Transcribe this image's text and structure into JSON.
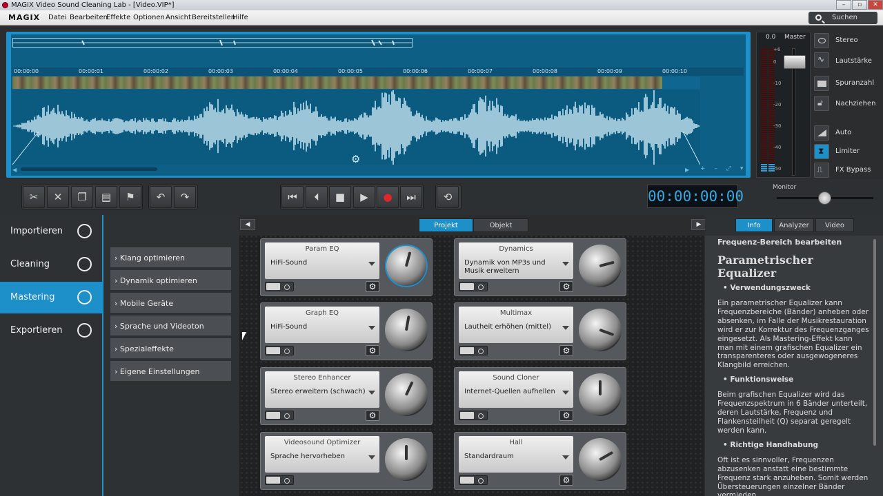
{
  "window": {
    "title": "MAGIX Video Sound Cleaning Lab - [Video.VIP*]"
  },
  "menu": {
    "logo": "MAGIX",
    "items": [
      "Datei",
      "Bearbeiten",
      "Effekte",
      "Optionen",
      "Ansicht",
      "Bereitstellen",
      "Hilfe"
    ],
    "search_label": "Suchen"
  },
  "timeline": {
    "ticks": [
      "00:00:00",
      "00:00:01",
      "00:00:02",
      "00:00:03",
      "00:00:04",
      "00:00:05",
      "00:00:06",
      "00:00:07",
      "00:00:08",
      "00:00:09",
      "00:00:10"
    ]
  },
  "master": {
    "level": "0.0",
    "label": "Master",
    "db_scale": [
      "+6",
      "0",
      "-10",
      "-20",
      "-30",
      "-40",
      "-50"
    ]
  },
  "side_controls": [
    "Stereo",
    "Lautstärke",
    "Spuranzahl",
    "Nachziehen",
    "Auto",
    "Limiter",
    "FX Bypass"
  ],
  "transport": {
    "timecode": "00:00:00:00",
    "monitor_label": "Monitor"
  },
  "nav": {
    "items": [
      {
        "label": "Importieren",
        "icon": "import-icon"
      },
      {
        "label": "Cleaning",
        "icon": "cleaning-icon"
      },
      {
        "label": "Mastering",
        "icon": "mastering-icon",
        "active": true
      },
      {
        "label": "Exportieren",
        "icon": "export-icon"
      }
    ]
  },
  "presets": [
    "Klang optimieren",
    "Dynamik optimieren",
    "Mobile Geräte",
    "Sprache und Videoton",
    "Spezialeffekte",
    "Eigene Einstellungen"
  ],
  "rack": {
    "tabs": [
      "Projekt",
      "Objekt"
    ],
    "active_tab": "Projekt"
  },
  "effects": [
    {
      "name": "Param EQ",
      "value": "HiFi-Sound"
    },
    {
      "name": "Dynamics",
      "value": "Dynamik von MP3s und Musik erweitern"
    },
    {
      "name": "Graph EQ",
      "value": "HiFi-Sound"
    },
    {
      "name": "Multimax",
      "value": "Lautheit erhöhen (mittel)"
    },
    {
      "name": "Stereo Enhancer",
      "value": "Stereo erweitern (schwach)"
    },
    {
      "name": "Sound Cloner",
      "value": "Internet-Quellen aufhellen"
    },
    {
      "name": "Videosound Optimizer",
      "value": "Sprache hervorheben"
    },
    {
      "name": "Hall",
      "value": "Standardraum"
    }
  ],
  "info": {
    "tabs": [
      "Info",
      "Analyzer",
      "Video"
    ],
    "active_tab": "Info",
    "heading": "Frequenz-Bereich bearbeiten",
    "title": "Parametrischer Equalizer",
    "sections": [
      {
        "heading": "Verwendungszweck",
        "text": "Ein parametrischer Equalizer kann Frequenzbereiche (Bänder) anheben oder absenken, im Falle der Musikrestauration wird er zur Korrektur des Frequenzganges eingesetzt. Als Mastering-Effekt kann man mit einem grafischen Equalizer ein transparenteres oder ausgewogeneres Klangbild erreichen."
      },
      {
        "heading": "Funktionsweise",
        "text": "Beim grafischen Equalizer wird das Frequenzspektrum in 6 Bänder unterteilt, deren Lautstärke, Frequenz und Flankensteilheit (Q) separat geregelt werden kann."
      },
      {
        "heading": "Richtige Handhabung",
        "text": "Oft ist es sinnvoller, Frequenzen abzusenken anstatt eine bestimmte Frequenz stark anzuheben. Somit werden Übersteuerungen einzelner Bänder vermieden."
      }
    ]
  },
  "colors": {
    "accent": "#1d8fc9",
    "waveform": "#cdeaf5",
    "timecode": "#36a9e1"
  }
}
